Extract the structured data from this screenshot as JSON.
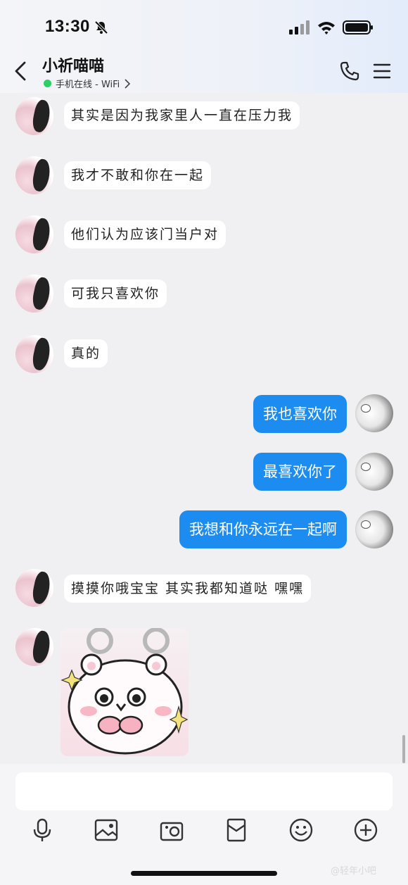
{
  "status_bar": {
    "time": "13:30"
  },
  "header": {
    "contact_name": "小祈喵喵",
    "status_text": "手机在线 - WiFi"
  },
  "messages": [
    {
      "side": "in",
      "text": "其实是因为我家里人一直在压力我"
    },
    {
      "side": "in",
      "text": "我才不敢和你在一起"
    },
    {
      "side": "in",
      "text": "他们认为应该门当户对"
    },
    {
      "side": "in",
      "text": "可我只喜欢你"
    },
    {
      "side": "in",
      "text": "真的"
    },
    {
      "side": "out",
      "text": "我也喜欢你"
    },
    {
      "side": "out",
      "text": "最喜欢你了"
    },
    {
      "side": "out",
      "text": "我想和你永远在一起啊"
    },
    {
      "side": "in",
      "text": "摸摸你哦宝宝 其实我都知道哒 嘿嘿"
    },
    {
      "side": "in",
      "type": "sticker",
      "icon": "bear-sticker"
    }
  ],
  "composer": {
    "input_value": "",
    "tools": [
      "microphone-icon",
      "image-icon",
      "camera-icon",
      "red-packet-icon",
      "emoji-icon",
      "plus-icon"
    ]
  },
  "watermark": "@轻年小吧",
  "colors": {
    "accent": "#1c8cf0",
    "online": "#2fcf67",
    "background": "#f0f0f2"
  }
}
